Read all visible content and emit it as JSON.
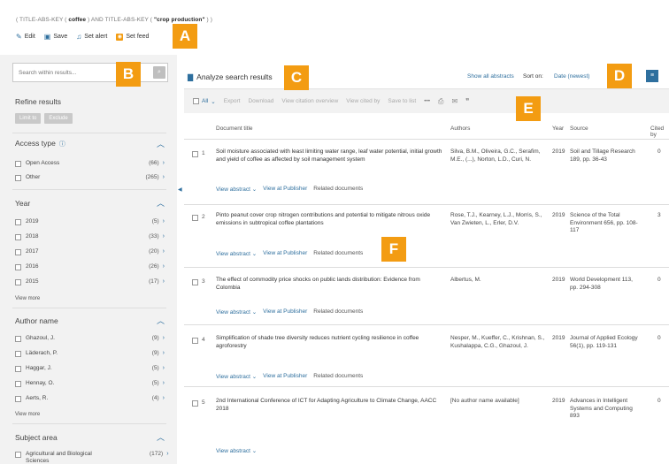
{
  "query": {
    "p1": "( TITLE-ABS-KEY ( ",
    "t1": "coffee",
    "p2": " ) AND TITLE-ABS-KEY ( ",
    "t2": "\"crop production\"",
    "p3": " ) )"
  },
  "actions": {
    "edit": "Edit",
    "save": "Save",
    "alert": "Set alert",
    "feed": "Set feed"
  },
  "sidebar": {
    "search_placeholder": "Search within results...",
    "refine_title": "Refine results",
    "limit_to": "Limit to",
    "exclude": "Exclude",
    "view_more": "View more",
    "facets": [
      {
        "title": "Access type",
        "items": [
          {
            "label": "Open Access",
            "count": "(66)"
          },
          {
            "label": "Other",
            "count": "(265)"
          }
        ]
      },
      {
        "title": "Year",
        "items": [
          {
            "label": "2019",
            "count": "(5)"
          },
          {
            "label": "2018",
            "count": "(33)"
          },
          {
            "label": "2017",
            "count": "(20)"
          },
          {
            "label": "2016",
            "count": "(26)"
          },
          {
            "label": "2015",
            "count": "(17)"
          }
        ]
      },
      {
        "title": "Author name",
        "items": [
          {
            "label": "Ghazoul, J.",
            "count": "(9)"
          },
          {
            "label": "Läderach, P.",
            "count": "(9)"
          },
          {
            "label": "Haggar, J.",
            "count": "(5)"
          },
          {
            "label": "Hennay, O.",
            "count": "(5)"
          },
          {
            "label": "Aerts, R.",
            "count": "(4)"
          }
        ]
      },
      {
        "title": "Subject area",
        "items": [
          {
            "label": "Agricultural and Biological Sciences",
            "count": "(172)"
          }
        ]
      }
    ]
  },
  "main": {
    "analyze": "Analyze search results",
    "show_all": "Show all abstracts",
    "sort_on": "Sort on:",
    "sort_value": "Date (newest)",
    "toolbar": {
      "all": "All",
      "export": "Export",
      "download": "Download",
      "citation": "View citation overview",
      "cited_by": "View cited by",
      "save_list": "Save to list",
      "more": "•••"
    },
    "columns": {
      "title": "Document title",
      "authors": "Authors",
      "year": "Year",
      "source": "Source",
      "cited": "Cited by"
    },
    "link_labels": {
      "abstract": "View abstract",
      "publisher": "View at Publisher",
      "related": "Related documents"
    },
    "rows": [
      {
        "num": "1",
        "title": "Soil moisture associated with least limiting water range, leaf water potential, initial growth and yield of coffee as affected by soil management system",
        "authors": "Silva, B.M., Oliveira, G.C., Serafim, M.E., (...), Norton, L.D., Curi, N.",
        "year": "2019",
        "source": "Soil and Tillage Research 189, pp. 36-43",
        "cited": "0"
      },
      {
        "num": "2",
        "title": "Pinto peanut cover crop nitrogen contributions and potential to mitigate nitrous oxide emissions in subtropical coffee plantations",
        "authors": "Rose, T.J., Kearney, L.J., Morris, S., Van Zwieten, L., Erler, D.V.",
        "year": "2019",
        "source": "Science of the Total Environment 656, pp. 108-117",
        "cited": "3"
      },
      {
        "num": "3",
        "title": "The effect of commodity price shocks on public lands distribution: Evidence from Colombia",
        "authors": "Albertus, M.",
        "year": "2019",
        "source": "World Development 113, pp. 294-308",
        "cited": "0"
      },
      {
        "num": "4",
        "title": "Simplification of shade tree diversity reduces nutrient cycling resilience in coffee agroforestry",
        "authors": "Nesper, M., Kueffer, C., Krishnan, S., Kushalappa, C.G., Ghazoul, J.",
        "year": "2019",
        "source": "Journal of Applied Ecology 56(1), pp. 119-131",
        "cited": "0"
      },
      {
        "num": "5",
        "title": "2nd International Conference of ICT for Adapting Agriculture to Climate Change, AACC 2018",
        "authors": "[No author name available]",
        "year": "2019",
        "source": "Advances in Intelligent Systems and Computing 893",
        "cited": "0"
      }
    ]
  },
  "badges": [
    "A",
    "B",
    "C",
    "D",
    "E",
    "F"
  ],
  "colors": {
    "accent": "#2e6f9e",
    "badge": "#f39c12",
    "sidebar_bg": "#f2f2f2"
  }
}
